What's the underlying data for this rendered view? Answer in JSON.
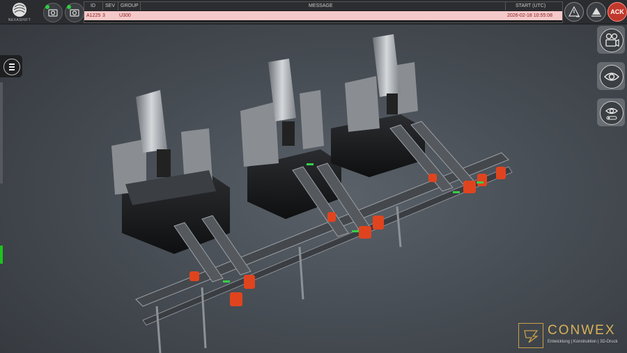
{
  "brand_logo": {
    "text": "NEXASHIFT"
  },
  "alarm_table": {
    "headers": {
      "id": "ID",
      "sev": "SEV",
      "group": "GROUP",
      "message": "MESSAGE",
      "start": "START (UTC)"
    },
    "row": {
      "id": "A1225",
      "sev": "3",
      "group": "U300",
      "message": "",
      "start": "2026-02-18 10:55:08"
    }
  },
  "toolbar": {
    "ack_label": "ACK"
  },
  "watermark": {
    "name": "CONWEX",
    "tagline": "Entwicklung | Konstruktion | 3D-Druck"
  },
  "icons": {
    "left_buttons": [
      "camera-icon",
      "camera-icon"
    ],
    "right_top": [
      "alarm-warning-icon",
      "alarm-archive-icon"
    ],
    "side": [
      "film-camera-icon",
      "eye-icon",
      "eye-settings-icon"
    ],
    "menu": "hamburger-menu-icon"
  },
  "colors": {
    "ack": "#c0392b",
    "alarm_row": "#f4c9c9",
    "status_ok": "#2ecc40",
    "brand": "#d7b15a"
  }
}
